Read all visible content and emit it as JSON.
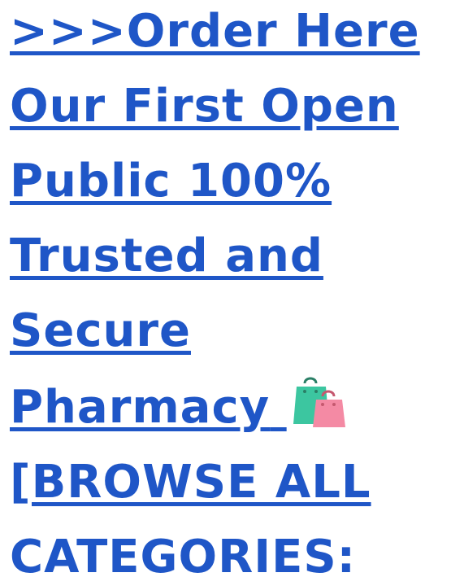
{
  "lines": [
    ">>>Order Here",
    "Our First Open",
    "Public 100%",
    "Trusted and",
    "Secure",
    "Pharmacy",
    "[BROWSE ALL",
    "CATEGORIES:"
  ],
  "icon": "shopping-bags-icon",
  "colors": {
    "link": "#1f56c7",
    "bag_green": "#3cc6a0",
    "bag_pink": "#f48aa4"
  }
}
